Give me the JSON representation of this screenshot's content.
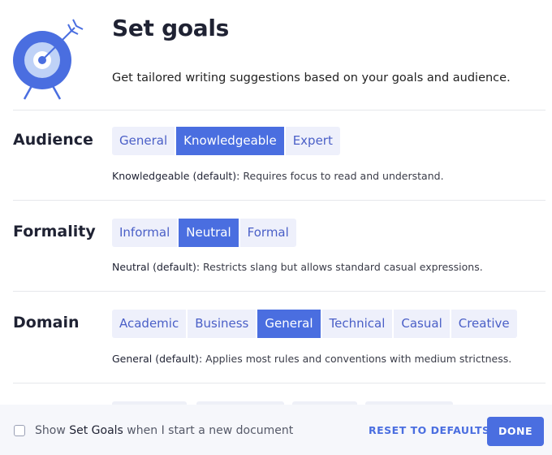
{
  "header": {
    "title": "Set goals",
    "subtitle": "Get tailored writing suggestions based on your goals and audience."
  },
  "colors": {
    "accent": "#4a6ee0",
    "option_bg": "#eef0fb",
    "option_text": "#4a5fc7"
  },
  "sections": [
    {
      "label": "Audience",
      "options": [
        "General",
        "Knowledgeable",
        "Expert"
      ],
      "selected": "Knowledgeable",
      "desc_key": "Knowledgeable (default):",
      "desc_text": " Requires focus to read and understand."
    },
    {
      "label": "Formality",
      "options": [
        "Informal",
        "Neutral",
        "Formal"
      ],
      "selected": "Neutral",
      "desc_key": "Neutral (default):",
      "desc_text": " Restricts slang but allows standard casual expressions."
    },
    {
      "label": "Domain",
      "options": [
        "Academic",
        "Business",
        "General",
        "Technical",
        "Casual",
        "Creative"
      ],
      "selected": "General",
      "desc_key": "General (default):",
      "desc_text": " Applies most rules and conventions with medium strictness."
    }
  ],
  "footer": {
    "checkbox_checked": false,
    "checkbox_pre": "Show ",
    "checkbox_strong": "Set Goals",
    "checkbox_post": " when I start a new document",
    "reset_label": "RESET TO DEFAULTS",
    "done_label": "DONE"
  }
}
